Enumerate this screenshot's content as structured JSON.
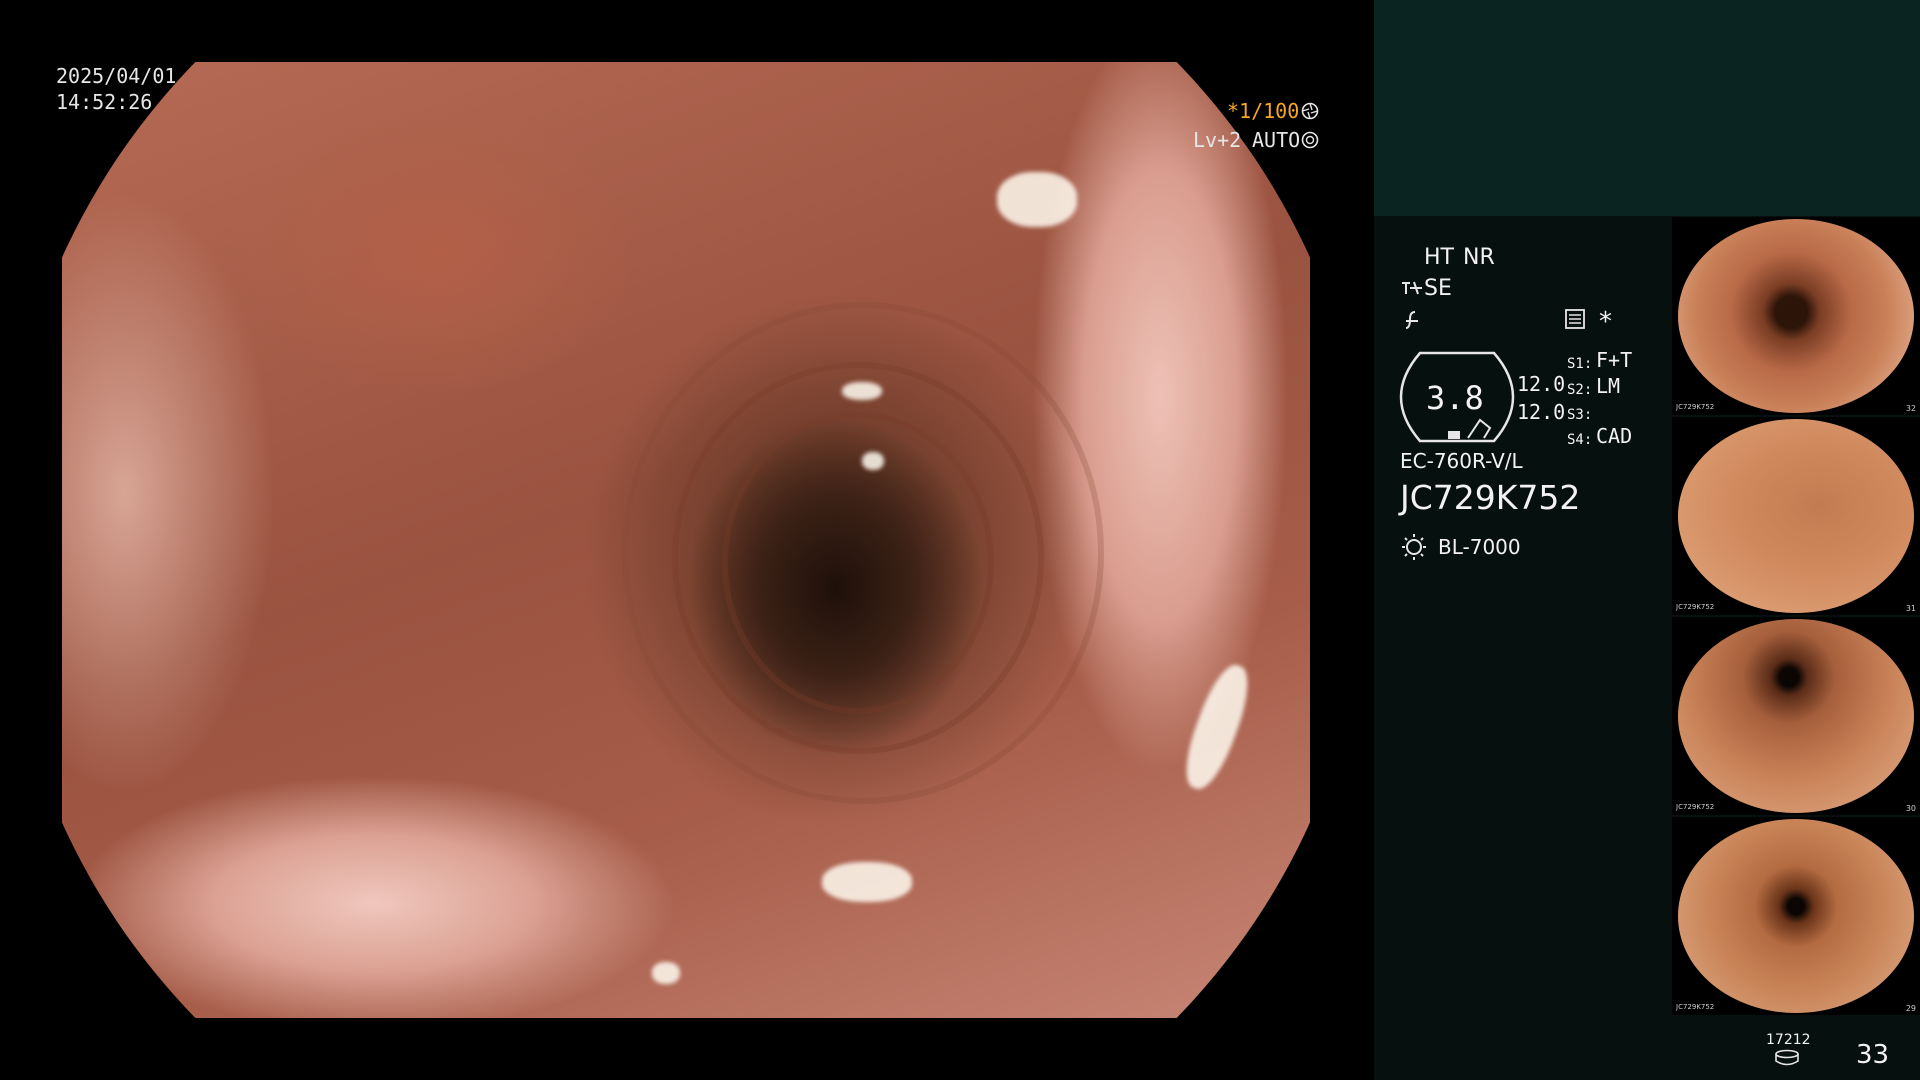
{
  "overlay": {
    "date": "2025/04/01",
    "time": "14:52:26",
    "shutter": "*1/100",
    "level": "Lv+2",
    "mode": "AUTO"
  },
  "panel": {
    "ht": "HT",
    "nr": "NR",
    "se": "SE",
    "star": "*",
    "gauge_value": "3.8",
    "val_top": "12.0",
    "val_bottom": "12.0",
    "s1_label": "S1:",
    "s1_value": "F+T",
    "s2_label": "S2:",
    "s2_value": "LM",
    "s3_label": "S3:",
    "s3_value": "",
    "s4_label": "S4:",
    "s4_value": "CAD",
    "scope_model": "EC-760R-V/L",
    "serial": "JC729K752",
    "light_source": "BL-7000",
    "storage_count": "17212",
    "image_count": "33"
  },
  "thumbnails": [
    {
      "serial": "JC729K752",
      "index": "32"
    },
    {
      "serial": "JC729K752",
      "index": "31"
    },
    {
      "serial": "JC729K752",
      "index": "30"
    },
    {
      "serial": "JC729K752",
      "index": "29"
    }
  ],
  "colors": {
    "accent_orange": "#f5a623",
    "panel_bg": "#06110f",
    "panel_top": "#0a2422"
  }
}
